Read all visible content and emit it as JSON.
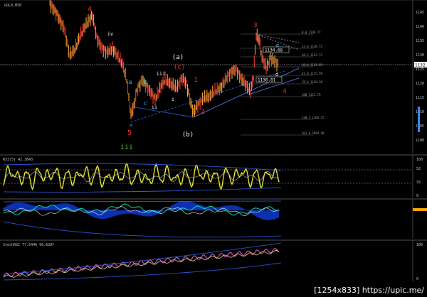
{
  "main": {
    "title": "GOLD,M30",
    "last_price_tag": "1132",
    "price_labels": [
      "1134.68",
      "1130.81"
    ],
    "axis_ticks": [
      "1145",
      "1140",
      "1135",
      "1130",
      "1125",
      "1120",
      "1115",
      "1110",
      "1105",
      "1100"
    ],
    "fib_levels": [
      {
        "label": "0.0 1146.72",
        "value": 1146.72
      },
      {
        "label": "23.6 1138.72",
        "value": 1138.72
      },
      {
        "label": "38.2 1133.73",
        "value": 1133.73
      },
      {
        "label": "50.0 1129.83",
        "value": 1129.83
      },
      {
        "label": "61.8 1125.59",
        "value": 1125.59
      },
      {
        "label": "78.6 1120.18",
        "value": 1120.18
      },
      {
        "label": "100 1113.73",
        "value": 1113.73
      },
      {
        "label": "138.2 1103.52",
        "value": 1103.52
      },
      {
        "label": "161.8 1094.28",
        "value": 1094.28
      }
    ],
    "wave_labels": [
      "4",
      "3",
      "5",
      "iii",
      "iv",
      "iii",
      "ii",
      "i",
      "(a)",
      "(b)",
      "(c)",
      "a",
      "b",
      "c",
      "e",
      "d",
      "v",
      "1",
      "2",
      "4"
    ]
  },
  "rsi": {
    "title": "RSI(5) 42.3643",
    "ticks": [
      "100",
      "52",
      "32",
      "0"
    ]
  },
  "macd": {
    "title": "",
    "ticks": []
  },
  "stoch": {
    "title": "StochRSI 77.6446 90.6207",
    "ticks": [
      "100",
      "0"
    ]
  },
  "watermark": "[1254x833] https://upic.me/",
  "colors": {
    "bull_candle": "#ffaa33",
    "bear_candle": "#ff3333",
    "wave_red": "#ff2a2a",
    "wave_white": "#ffffff",
    "wave_cyan": "#33ccff",
    "wave_green": "#55cc33",
    "rsi_line": "#ffff33",
    "rsi_highlight": "#ff33ff",
    "macd_histogram": "#1144ff",
    "stoch_line": "#ff66cc",
    "trend_blue": "#3366ff"
  }
}
